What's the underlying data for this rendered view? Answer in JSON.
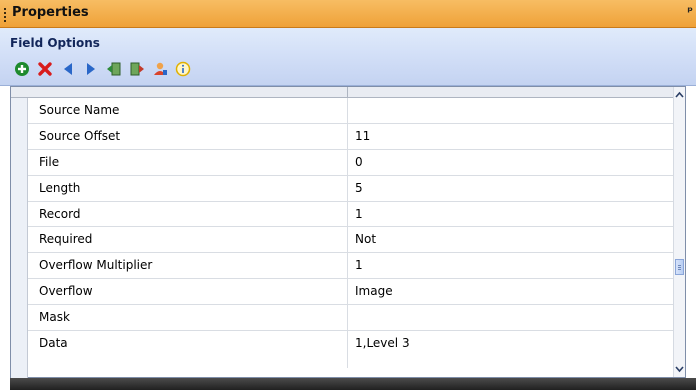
{
  "panel": {
    "title": "Properties",
    "pin_glyph": "ᵖ"
  },
  "section": {
    "title": "Field Options"
  },
  "toolbar": {
    "buttons": [
      {
        "name": "add-icon",
        "color": "#1e8a2e"
      },
      {
        "name": "delete-icon",
        "color": "#d81c1c"
      },
      {
        "name": "move-left-icon",
        "color": "#2a67c8"
      },
      {
        "name": "move-right-icon",
        "color": "#2a67c8"
      },
      {
        "name": "import-icon",
        "color": "#2e8b3a"
      },
      {
        "name": "export-icon",
        "color": "#2e8b3a"
      },
      {
        "name": "user-alert-icon",
        "color": "#d9442b"
      },
      {
        "name": "info-icon",
        "color": "#e0b000"
      }
    ]
  },
  "properties": [
    {
      "name": "Source Name",
      "value": ""
    },
    {
      "name": "Source Offset",
      "value": "11"
    },
    {
      "name": "File",
      "value": "0"
    },
    {
      "name": "Length",
      "value": "5"
    },
    {
      "name": "Record",
      "value": "1"
    },
    {
      "name": "Required",
      "value": "Not"
    },
    {
      "name": "Overflow Multiplier",
      "value": "1"
    },
    {
      "name": "Overflow",
      "value": "Image"
    },
    {
      "name": "Mask",
      "value": ""
    },
    {
      "name": "Data",
      "value": "1,Level 3"
    }
  ],
  "colors": {
    "title_bar": "#efa138",
    "section_bar": "#cfdcf6"
  }
}
